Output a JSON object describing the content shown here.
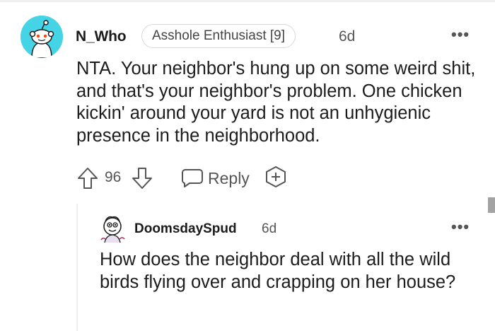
{
  "comment": {
    "author": "N_Who",
    "flair": "Asshole Enthusiast [9]",
    "time": "6d",
    "more": "•••",
    "avatar_icon": "snoo-avatar-icon",
    "body": "NTA. Your neighbor's hung up on some weird shit, and that's your neighbor's problem. One chicken kickin' around your yard is not an unhygienic presence in the neighborhood.",
    "score": "96",
    "reply_label": "Reply"
  },
  "reply": {
    "author": "DoomsdaySpud",
    "time": "6d",
    "more": "•••",
    "avatar_icon": "cartoon-avatar-icon",
    "body": "How does the neighbor deal with all the wild birds flying over and crapping on her house?"
  },
  "colors": {
    "avatar_bg": "#45d3e6",
    "text": "#1a1a1b",
    "muted": "#555555",
    "border": "#d6d8da"
  }
}
